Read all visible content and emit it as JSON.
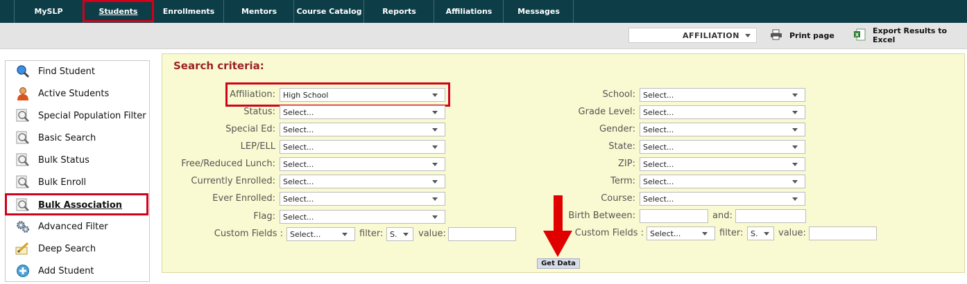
{
  "nav": {
    "tabs": [
      {
        "label": "MySLP"
      },
      {
        "label": "Students"
      },
      {
        "label": "Enrollments"
      },
      {
        "label": "Mentors"
      },
      {
        "label": "Course Catalog"
      },
      {
        "label": "Reports"
      },
      {
        "label": "Affiliations"
      },
      {
        "label": "Messages"
      }
    ],
    "active_tab": "Students"
  },
  "toolbar": {
    "affiliation_select": "AFFILIATION",
    "print_label": "Print page",
    "export_label": "Export Results to Excel"
  },
  "sidebar": {
    "items": [
      {
        "label": "Find Student",
        "icon": "magnifier-blue-icon"
      },
      {
        "label": "Active Students",
        "icon": "person-icon"
      },
      {
        "label": "Special Population Filter",
        "icon": "magnifier-doc-icon"
      },
      {
        "label": "Basic Search",
        "icon": "magnifier-doc-icon"
      },
      {
        "label": "Bulk Status",
        "icon": "magnifier-doc-icon"
      },
      {
        "label": "Bulk Enroll",
        "icon": "magnifier-doc-icon"
      },
      {
        "label": "Bulk Association",
        "icon": "magnifier-doc-icon"
      },
      {
        "label": "Advanced Filter",
        "icon": "gears-icon"
      },
      {
        "label": "Deep Search",
        "icon": "pencil-paper-icon"
      },
      {
        "label": "Add Student",
        "icon": "add-circle-icon"
      }
    ],
    "active_item": "Bulk Association"
  },
  "search": {
    "title": "Search criteria:",
    "left_fields": [
      {
        "label": "Affiliation:",
        "value": "High School"
      },
      {
        "label": "Status:",
        "value": "Select..."
      },
      {
        "label": "Special Ed:",
        "value": "Select..."
      },
      {
        "label": "LEP/ELL",
        "value": "Select..."
      },
      {
        "label": "Free/Reduced Lunch:",
        "value": "Select..."
      },
      {
        "label": "Currently Enrolled:",
        "value": "Select..."
      },
      {
        "label": "Ever Enrolled:",
        "value": "Select..."
      },
      {
        "label": "Flag:",
        "value": "Select..."
      }
    ],
    "right_fields": [
      {
        "label": "School:",
        "value": "Select..."
      },
      {
        "label": "Grade Level:",
        "value": "Select..."
      },
      {
        "label": "Gender:",
        "value": "Select..."
      },
      {
        "label": "State:",
        "value": "Select..."
      },
      {
        "label": "ZIP:",
        "value": "Select..."
      },
      {
        "label": "Term:",
        "value": "Select..."
      },
      {
        "label": "Course:",
        "value": "Select..."
      }
    ],
    "birth_between_label": "Birth Between:",
    "and_label": "and:",
    "custom_left": {
      "label": "Custom Fields :",
      "select": "Select...",
      "filter_label": "filter:",
      "filter_value": "S.",
      "value_label": "value:"
    },
    "custom_right": {
      "label": "Custom Fields :",
      "select": "Select...",
      "filter_label": "filter:",
      "filter_value": "S.",
      "value_label": "value:"
    },
    "get_data_label": "Get Data"
  }
}
